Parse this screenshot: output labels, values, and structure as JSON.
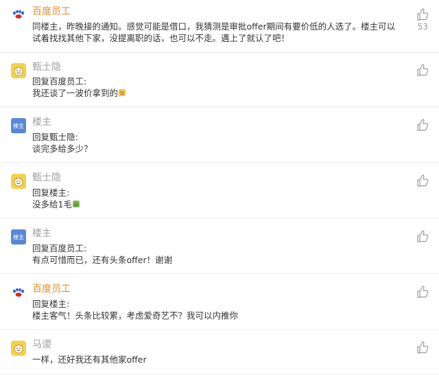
{
  "comments": [
    {
      "name": "百度员工",
      "text": "同楼主，昨晚接的通知。感觉可能是借口，我猜测是审批offer期间有要价低的人选了。楼主可以试着找找其他下家，没提离职的话，也可以不走。遇上了就认了吧！",
      "likes": "53"
    },
    {
      "name": "甄士隐",
      "reply_to": "回复百度员工:",
      "text": "我还谈了一波价拿到的"
    },
    {
      "name": "楼主",
      "reply_to": "回复甄士隐:",
      "text": "谈完多给多少？"
    },
    {
      "name": "甄士隐",
      "reply_to": "回复楼主:",
      "text": "没多给1毛"
    },
    {
      "name": "楼主",
      "reply_to": "回复百度员工:",
      "text": "有点可惜而已，还有头条offer！谢谢"
    },
    {
      "name": "百度员工",
      "reply_to": "回复楼主:",
      "text": "楼主客气！头条比较累，考虑爱奇艺不？我可以内推你"
    },
    {
      "name": "马谡",
      "text": "一样，还好我还有其他家offer"
    }
  ],
  "avatar_op_label": "楼主",
  "colors": {
    "name_highlight": "#e58b2c",
    "name_default": "#a0a0a0",
    "divider": "#eeeeee"
  }
}
